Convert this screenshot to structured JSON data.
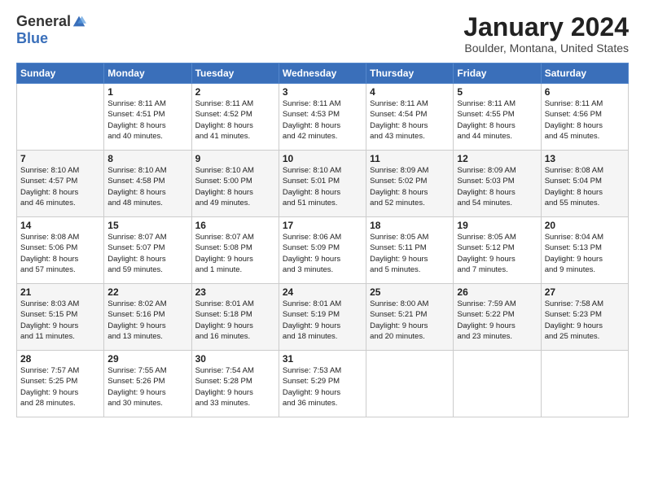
{
  "logo": {
    "general": "General",
    "blue": "Blue"
  },
  "title": "January 2024",
  "location": "Boulder, Montana, United States",
  "days_header": [
    "Sunday",
    "Monday",
    "Tuesday",
    "Wednesday",
    "Thursday",
    "Friday",
    "Saturday"
  ],
  "weeks": [
    [
      {
        "day": "",
        "info": ""
      },
      {
        "day": "1",
        "info": "Sunrise: 8:11 AM\nSunset: 4:51 PM\nDaylight: 8 hours\nand 40 minutes."
      },
      {
        "day": "2",
        "info": "Sunrise: 8:11 AM\nSunset: 4:52 PM\nDaylight: 8 hours\nand 41 minutes."
      },
      {
        "day": "3",
        "info": "Sunrise: 8:11 AM\nSunset: 4:53 PM\nDaylight: 8 hours\nand 42 minutes."
      },
      {
        "day": "4",
        "info": "Sunrise: 8:11 AM\nSunset: 4:54 PM\nDaylight: 8 hours\nand 43 minutes."
      },
      {
        "day": "5",
        "info": "Sunrise: 8:11 AM\nSunset: 4:55 PM\nDaylight: 8 hours\nand 44 minutes."
      },
      {
        "day": "6",
        "info": "Sunrise: 8:11 AM\nSunset: 4:56 PM\nDaylight: 8 hours\nand 45 minutes."
      }
    ],
    [
      {
        "day": "7",
        "info": "Sunrise: 8:10 AM\nSunset: 4:57 PM\nDaylight: 8 hours\nand 46 minutes."
      },
      {
        "day": "8",
        "info": "Sunrise: 8:10 AM\nSunset: 4:58 PM\nDaylight: 8 hours\nand 48 minutes."
      },
      {
        "day": "9",
        "info": "Sunrise: 8:10 AM\nSunset: 5:00 PM\nDaylight: 8 hours\nand 49 minutes."
      },
      {
        "day": "10",
        "info": "Sunrise: 8:10 AM\nSunset: 5:01 PM\nDaylight: 8 hours\nand 51 minutes."
      },
      {
        "day": "11",
        "info": "Sunrise: 8:09 AM\nSunset: 5:02 PM\nDaylight: 8 hours\nand 52 minutes."
      },
      {
        "day": "12",
        "info": "Sunrise: 8:09 AM\nSunset: 5:03 PM\nDaylight: 8 hours\nand 54 minutes."
      },
      {
        "day": "13",
        "info": "Sunrise: 8:08 AM\nSunset: 5:04 PM\nDaylight: 8 hours\nand 55 minutes."
      }
    ],
    [
      {
        "day": "14",
        "info": "Sunrise: 8:08 AM\nSunset: 5:06 PM\nDaylight: 8 hours\nand 57 minutes."
      },
      {
        "day": "15",
        "info": "Sunrise: 8:07 AM\nSunset: 5:07 PM\nDaylight: 8 hours\nand 59 minutes."
      },
      {
        "day": "16",
        "info": "Sunrise: 8:07 AM\nSunset: 5:08 PM\nDaylight: 9 hours\nand 1 minute."
      },
      {
        "day": "17",
        "info": "Sunrise: 8:06 AM\nSunset: 5:09 PM\nDaylight: 9 hours\nand 3 minutes."
      },
      {
        "day": "18",
        "info": "Sunrise: 8:05 AM\nSunset: 5:11 PM\nDaylight: 9 hours\nand 5 minutes."
      },
      {
        "day": "19",
        "info": "Sunrise: 8:05 AM\nSunset: 5:12 PM\nDaylight: 9 hours\nand 7 minutes."
      },
      {
        "day": "20",
        "info": "Sunrise: 8:04 AM\nSunset: 5:13 PM\nDaylight: 9 hours\nand 9 minutes."
      }
    ],
    [
      {
        "day": "21",
        "info": "Sunrise: 8:03 AM\nSunset: 5:15 PM\nDaylight: 9 hours\nand 11 minutes."
      },
      {
        "day": "22",
        "info": "Sunrise: 8:02 AM\nSunset: 5:16 PM\nDaylight: 9 hours\nand 13 minutes."
      },
      {
        "day": "23",
        "info": "Sunrise: 8:01 AM\nSunset: 5:18 PM\nDaylight: 9 hours\nand 16 minutes."
      },
      {
        "day": "24",
        "info": "Sunrise: 8:01 AM\nSunset: 5:19 PM\nDaylight: 9 hours\nand 18 minutes."
      },
      {
        "day": "25",
        "info": "Sunrise: 8:00 AM\nSunset: 5:21 PM\nDaylight: 9 hours\nand 20 minutes."
      },
      {
        "day": "26",
        "info": "Sunrise: 7:59 AM\nSunset: 5:22 PM\nDaylight: 9 hours\nand 23 minutes."
      },
      {
        "day": "27",
        "info": "Sunrise: 7:58 AM\nSunset: 5:23 PM\nDaylight: 9 hours\nand 25 minutes."
      }
    ],
    [
      {
        "day": "28",
        "info": "Sunrise: 7:57 AM\nSunset: 5:25 PM\nDaylight: 9 hours\nand 28 minutes."
      },
      {
        "day": "29",
        "info": "Sunrise: 7:55 AM\nSunset: 5:26 PM\nDaylight: 9 hours\nand 30 minutes."
      },
      {
        "day": "30",
        "info": "Sunrise: 7:54 AM\nSunset: 5:28 PM\nDaylight: 9 hours\nand 33 minutes."
      },
      {
        "day": "31",
        "info": "Sunrise: 7:53 AM\nSunset: 5:29 PM\nDaylight: 9 hours\nand 36 minutes."
      },
      {
        "day": "",
        "info": ""
      },
      {
        "day": "",
        "info": ""
      },
      {
        "day": "",
        "info": ""
      }
    ]
  ]
}
